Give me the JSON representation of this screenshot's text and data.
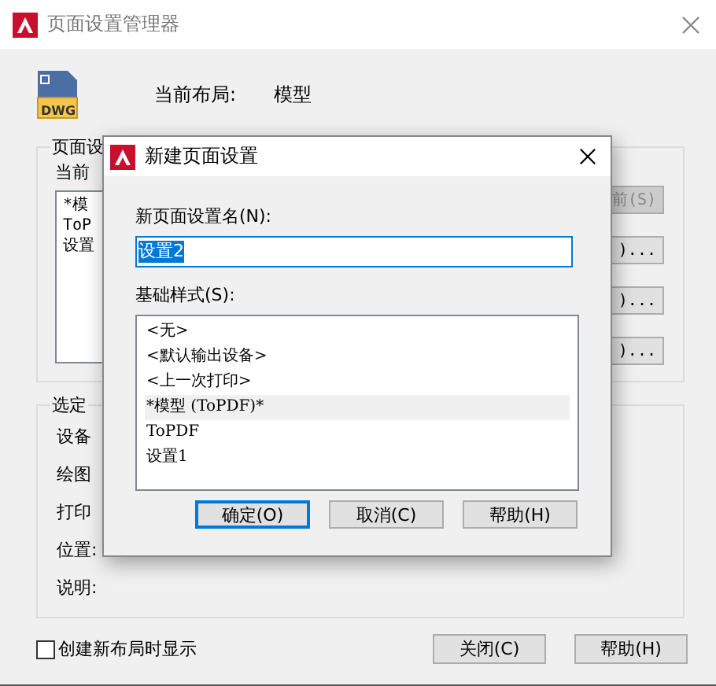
{
  "window": {
    "title": "页面设置管理器"
  },
  "current_layout": {
    "file_icon_label": "DWG",
    "label": "当前布局:",
    "value": "模型"
  },
  "page_setups_group": {
    "label": "页面设",
    "current_label": "当前",
    "items": [
      "*模",
      "ToP",
      "设置"
    ],
    "side_buttons": [
      "前(S)",
      ")...",
      ")...",
      ")..."
    ]
  },
  "selected_group": {
    "label": "选定",
    "fields": [
      "设备",
      "绘图",
      "打印",
      "位置:",
      "说明:"
    ]
  },
  "show_on_create": {
    "label": "创建新布局时显示",
    "checked": false
  },
  "buttons": [
    "关闭(C)",
    "帮助(H)"
  ],
  "dialog": {
    "title": "新建页面设置",
    "name_label": "新页面设置名(N):",
    "name_value": "设置2",
    "base_label": "基础样式(S):",
    "styles": [
      {
        "text": "<无>",
        "selected": false
      },
      {
        "text": "<默认输出设备>",
        "selected": false
      },
      {
        "text": "<上一次打印>",
        "selected": false
      },
      {
        "text": "*模型 (ToPDF)*",
        "selected": true
      },
      {
        "text": "ToPDF",
        "selected": false
      },
      {
        "text": "设置1",
        "selected": false
      }
    ],
    "buttons": [
      {
        "label": "确定(O)",
        "focused": true
      },
      {
        "label": "取消(C)",
        "focused": false
      },
      {
        "label": "帮助(H)",
        "focused": false
      }
    ]
  }
}
